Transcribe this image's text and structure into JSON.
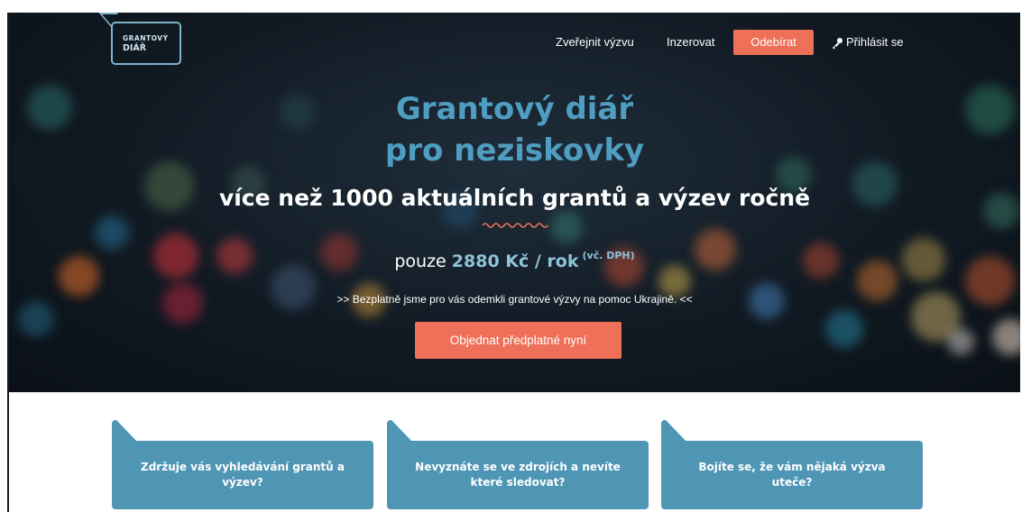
{
  "logo": {
    "line1": "GRANTOVÝ",
    "line2": "DIÁŘ"
  },
  "nav": {
    "publish": "Zveřejnit výzvu",
    "advertise": "Inzerovat",
    "subscribe": "Odebírat",
    "login": "Přihlásit se"
  },
  "hero": {
    "title_line1": "Grantový diář",
    "title_line2": "pro neziskovky",
    "subtitle": "více než 1000 aktuálních grantů a výzev ročně",
    "price_prefix": "pouze",
    "price_amount": "2880 Kč / rok",
    "price_vat": "(vč. DPH)",
    "notice": ">> Bezplatně jsme pro vás odemkli grantové výzvy na pomoc Ukrajině. <<",
    "cta": "Objednat předplatné nyní"
  },
  "cards": [
    {
      "text": "Zdržuje vás vyhledávání grantů a výzev?"
    },
    {
      "text": "Nevyznáte se ve zdrojích a nevíte které sledovat?"
    },
    {
      "text": "Bojíte se, že vám nějaká výzva uteče?"
    }
  ],
  "colors": {
    "accent": "#ee7058",
    "brand_blue": "#4f9dc1",
    "card_blue": "#4f96b4",
    "hero_bg": "#111a23"
  },
  "icons": {
    "login": "key-icon",
    "divider": "squiggle-icon"
  }
}
